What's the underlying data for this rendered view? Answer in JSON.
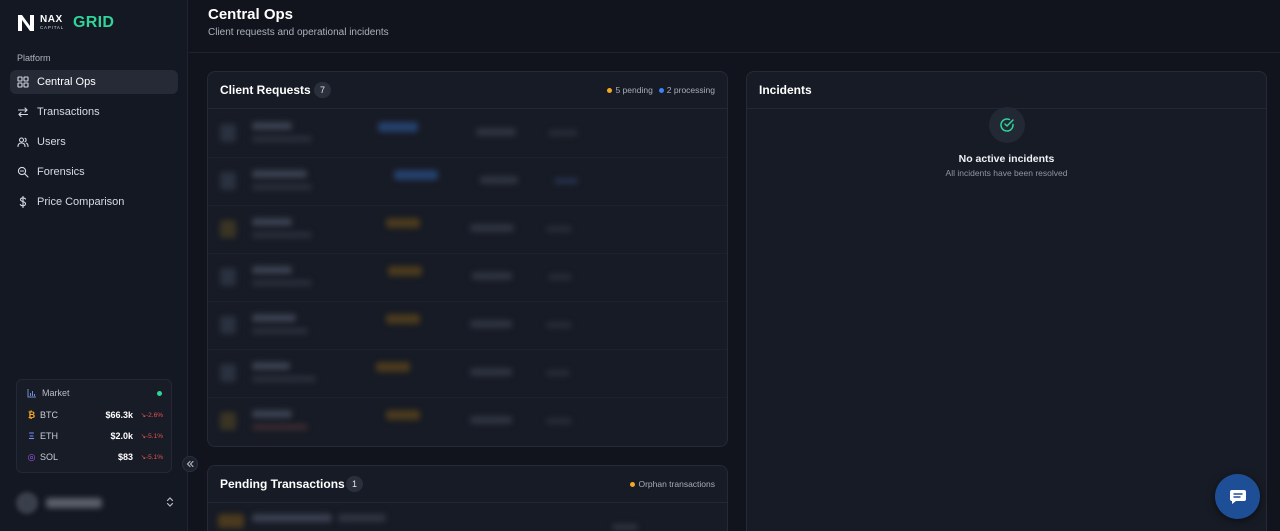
{
  "brand": {
    "nax": "NAX",
    "capital": "CAPITAL",
    "grid": "GRID"
  },
  "sidebar": {
    "section_label": "Platform",
    "items": [
      {
        "label": "Central Ops",
        "icon": "grid-icon",
        "active": true
      },
      {
        "label": "Transactions",
        "icon": "arrows-swap-icon",
        "active": false
      },
      {
        "label": "Users",
        "icon": "users-icon",
        "active": false
      },
      {
        "label": "Forensics",
        "icon": "search-zoom-icon",
        "active": false
      },
      {
        "label": "Price Comparison",
        "icon": "dollar-icon",
        "active": false
      }
    ]
  },
  "market": {
    "title": "Market",
    "rows": [
      {
        "symbol": "BTC",
        "glyph": "₿",
        "price": "$66.3k",
        "change": "↘-2.6%"
      },
      {
        "symbol": "ETH",
        "glyph": "Ξ",
        "price": "$2.0k",
        "change": "↘-5.1%"
      },
      {
        "symbol": "SOL",
        "glyph": "◎",
        "price": "$83",
        "change": "↘-5.1%"
      }
    ]
  },
  "header": {
    "title": "Central Ops",
    "subtitle": "Client requests and operational incidents"
  },
  "client_requests": {
    "title": "Client Requests",
    "count": "7",
    "legend": [
      {
        "label": "5 pending",
        "color": "#f5a623"
      },
      {
        "label": "2 processing",
        "color": "#3b82f6"
      }
    ]
  },
  "incidents": {
    "title": "Incidents",
    "empty_title": "No active incidents",
    "empty_subtitle": "All incidents have been resolved"
  },
  "pending_transactions": {
    "title": "Pending Transactions",
    "count": "1",
    "legend": [
      {
        "label": "Orphan transactions",
        "color": "#f5a623"
      }
    ]
  },
  "colors": {
    "accent_green": "#2fd49a",
    "negative": "#e2534f",
    "chat_button": "#1e4f96"
  }
}
